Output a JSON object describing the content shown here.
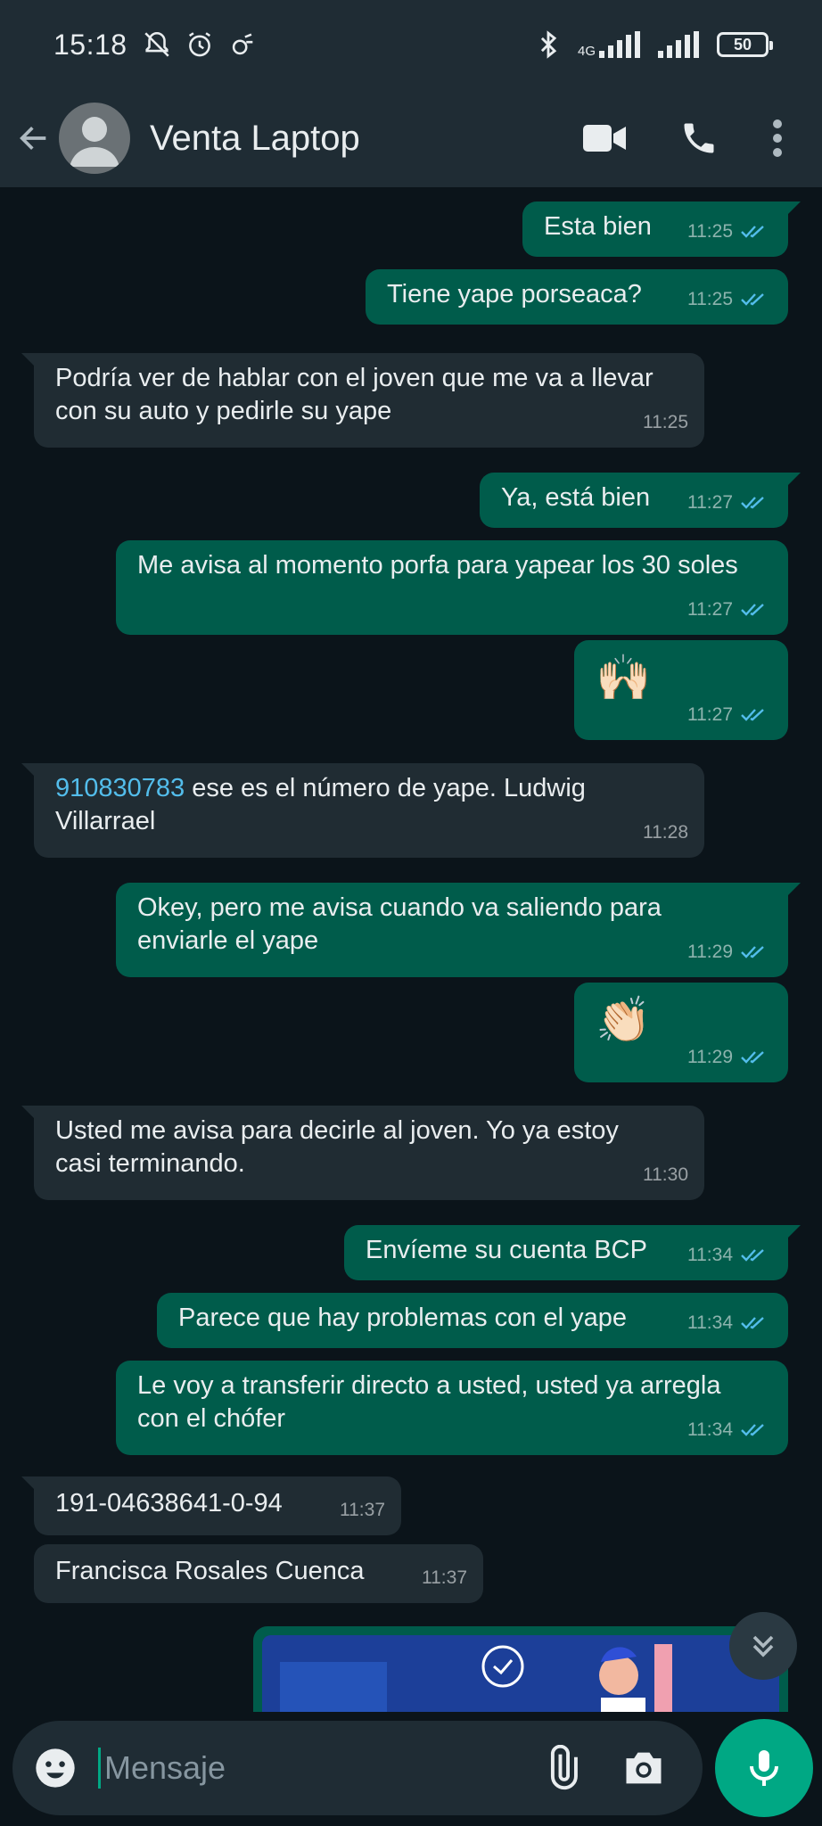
{
  "status_bar": {
    "time": "15:18",
    "network": "4G",
    "battery": "50"
  },
  "header": {
    "title": "Venta Laptop"
  },
  "messages": [
    {
      "dir": "out",
      "text": "Esta bien",
      "time": "11:25"
    },
    {
      "dir": "out",
      "text": "Tiene yape porseaca?",
      "time": "11:25"
    },
    {
      "dir": "in",
      "text": "Podría ver de hablar con el joven que me va a llevar con su auto y pedirle su yape",
      "time": "11:25"
    },
    {
      "dir": "out",
      "text": "Ya, está bien",
      "time": "11:27"
    },
    {
      "dir": "out",
      "text": "Me avisa al momento porfa para yapear los 30 soles",
      "time": "11:27"
    },
    {
      "dir": "out",
      "text": "🙌🏻",
      "time": "11:27"
    },
    {
      "dir": "in",
      "link": "910830783",
      "text": " ese es el número de yape. Ludwig Villarrael",
      "time": "11:28"
    },
    {
      "dir": "out",
      "text": "Okey, pero me avisa cuando va saliendo para enviarle el yape",
      "time": "11:29"
    },
    {
      "dir": "out",
      "text": "👏🏻",
      "time": "11:29"
    },
    {
      "dir": "in",
      "text": "Usted me avisa para decirle al joven. Yo ya estoy casi terminando.",
      "time": "11:30"
    },
    {
      "dir": "out",
      "text": "Envíeme su cuenta BCP",
      "time": "11:34"
    },
    {
      "dir": "out",
      "text": "Parece que hay problemas con el yape",
      "time": "11:34"
    },
    {
      "dir": "out",
      "text": "Le voy a transferir directo a usted, usted ya arregla con el chófer",
      "time": "11:34"
    },
    {
      "dir": "in",
      "text": "191-04638641-0-94",
      "time": "11:37"
    },
    {
      "dir": "in",
      "text": "Francisca Rosales Cuenca",
      "time": "11:37"
    }
  ],
  "input": {
    "placeholder": "Mensaje"
  },
  "colors": {
    "background": "#0b141a",
    "header": "#1f2c34",
    "outgoing_bubble": "#005c4b",
    "incoming_bubble": "#202c33",
    "accent": "#00a884",
    "read_ticks": "#53bdeb"
  },
  "icons": [
    "back-arrow-icon",
    "video-call-icon",
    "phone-icon",
    "more-vert-icon",
    "emoji-icon",
    "attach-icon",
    "camera-icon",
    "mic-icon",
    "scroll-down-icon"
  ]
}
